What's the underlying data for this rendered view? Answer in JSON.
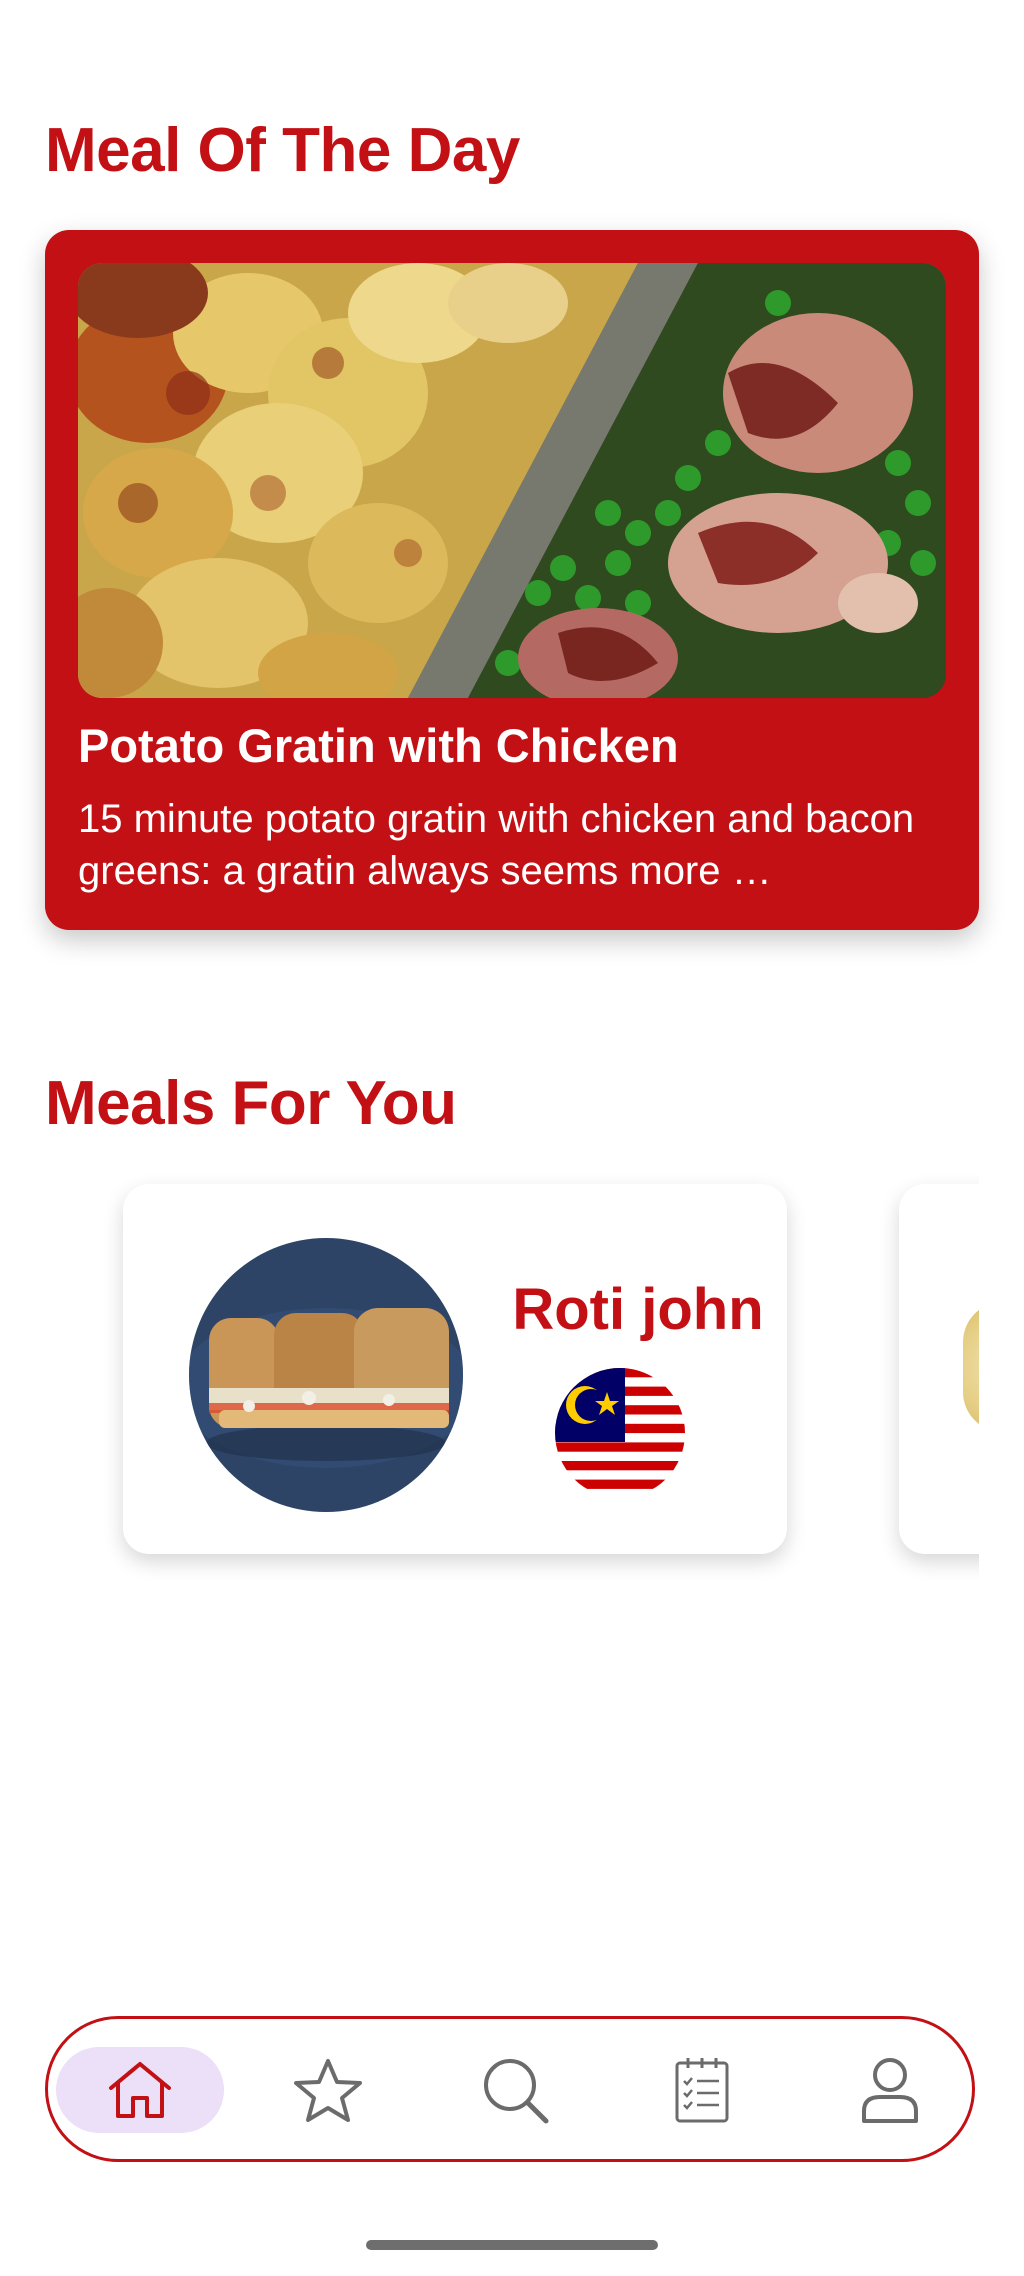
{
  "meal_of_the_day": {
    "section_title": "Meal Of The Day",
    "name": "Potato Gratin with Chicken",
    "description": "15 minute potato gratin with chicken and bacon greens: a gratin always seems more …"
  },
  "meals_for_you": {
    "section_title": "Meals For You",
    "items": [
      {
        "name": "Roti john",
        "flag": "malaysia-flag"
      }
    ]
  },
  "bottom_nav": {
    "items": [
      {
        "icon": "home-icon",
        "active": true
      },
      {
        "icon": "star-icon",
        "active": false
      },
      {
        "icon": "search-icon",
        "active": false
      },
      {
        "icon": "checklist-icon",
        "active": false
      },
      {
        "icon": "profile-icon",
        "active": false
      }
    ]
  },
  "colors": {
    "brand_red": "#c21014",
    "active_nav_pill": "#ebe0f7",
    "icon_gray": "#6b6b6b"
  }
}
